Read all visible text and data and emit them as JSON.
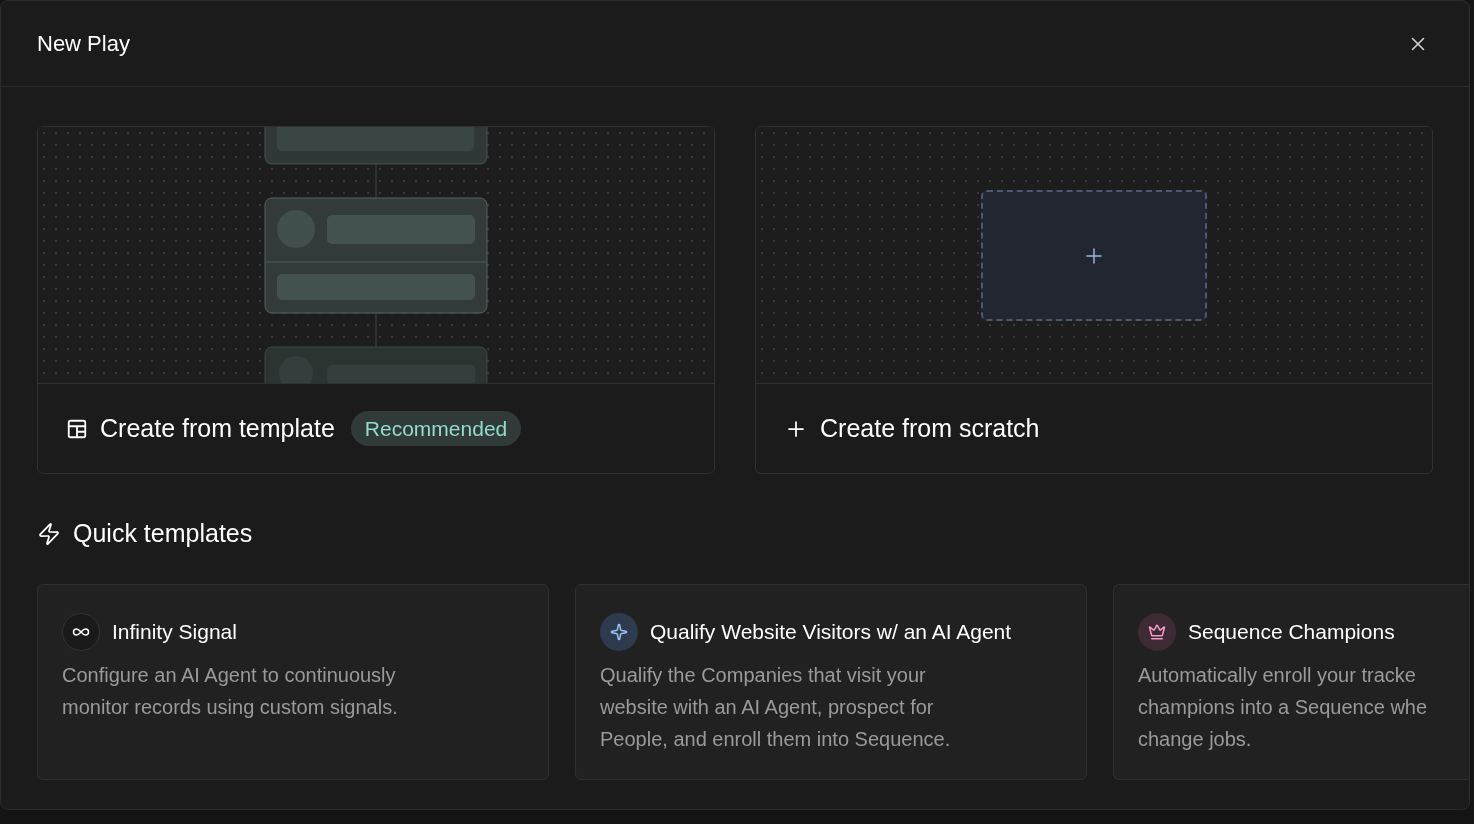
{
  "dialog": {
    "title": "New Play"
  },
  "options": [
    {
      "kind": "template",
      "label": "Create from template",
      "badge": "Recommended"
    },
    {
      "kind": "scratch",
      "label": "Create from scratch"
    }
  ],
  "quick_templates": {
    "heading": "Quick templates",
    "items": [
      {
        "kind": "infinity",
        "title": "Infinity Signal",
        "description": [
          "Configure an AI Agent to continuously",
          "monitor records using custom signals."
        ]
      },
      {
        "kind": "sparkle",
        "title": "Qualify Website Visitors w/ an AI Agent",
        "description": [
          "Qualify the Companies that visit your",
          "website with an AI Agent, prospect for",
          "People, and enroll them into Sequence."
        ]
      },
      {
        "kind": "crown",
        "title": "Sequence Champions",
        "description": [
          "Automatically enroll your tracke",
          "champions into a Sequence whe",
          "change jobs."
        ]
      }
    ]
  }
}
